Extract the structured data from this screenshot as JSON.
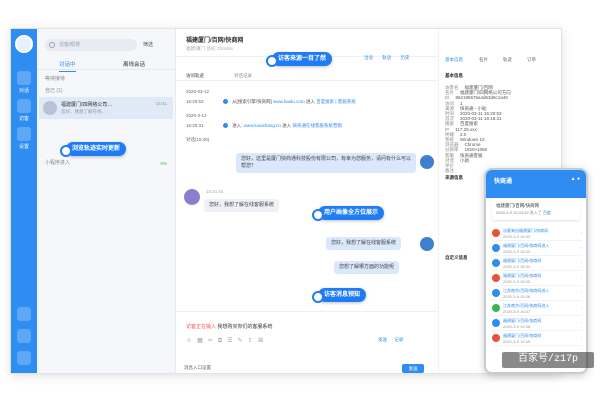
{
  "rail": {
    "labels": [
      "对话",
      "访客",
      "设置"
    ]
  },
  "contacts": {
    "search_placeholder": "访客/昵称",
    "filter_label": "筛选",
    "tabs": [
      "对话中",
      "离线会话"
    ],
    "group_labels": [
      "等待接待",
      "自己 (1)",
      "小程序进入"
    ],
    "visitor_name": "福建厦门/四网络公司…",
    "visitor_time": "15:41",
    "visitor_sub": "您好，我想了解在线…",
    "percent": "0%"
  },
  "main": {
    "title": "福建厦门/百网/快商网",
    "subtitle": "福建/厦门  访问  Chrome",
    "header_tabs": [
      "洽谈",
      "轨迹",
      "历史"
    ],
    "track_label": "访问轨迹",
    "track_label2": "对话记录",
    "tracks": [
      {
        "date": "2020-03-12",
        "time": "15:20:53",
        "src": "从[搜索引擎/快商网]",
        "link": "www.baidu.com",
        "enter": "进入",
        "lp": "百度搜索 | 客服系统"
      },
      {
        "date": "2020-3-12",
        "time": "15:20:31",
        "src": "进入:",
        "link": "www.kuaishang.cn",
        "enter": "进入",
        "lp": "快商通在线客服系统营销"
      }
    ],
    "dialog_tag": "对话(15:40)",
    "msgs": [
      {
        "text": "您好，这里是厦门快商通科技股份有限公司，有幸为您服务，请问有什么可以帮您？",
        "side": "right"
      },
      {
        "time": "15:41:54",
        "text": "您好，我想了解在线客服系统",
        "side": "left"
      },
      {
        "text": "您好，我想了解在线客服系统",
        "side": "right"
      },
      {
        "text": "您想了解哪方面的功能呢",
        "side": "right"
      }
    ],
    "typing_tag": "访客正在输入",
    "typing_text": "我想购买你们的客服系统",
    "tools": [
      "☺",
      "▦",
      "✂",
      "⧉",
      "☰",
      "✎",
      "⇧",
      "⌘"
    ],
    "send_links": [
      "发送",
      "记录"
    ],
    "auto_label": "消息入口设置",
    "send_btn": "发送"
  },
  "sidebar": {
    "tabs": [
      "基本信息",
      "名片",
      "轨迹",
      "订单"
    ],
    "sec1": "基本信息",
    "rows": [
      {
        "k": "访客名",
        "v": "福建厦门/百网"
      },
      {
        "k": "名片",
        "v": "福建厦门/四网络公司方向"
      },
      {
        "k": "ID",
        "v": "862195576a4d63d9c1a48"
      },
      {
        "k": "访问",
        "v": "1"
      },
      {
        "k": "来源",
        "v": "快商通 - 小助"
      },
      {
        "k": "时间",
        "v": "2020-03-11 15:20:53"
      },
      {
        "k": "首次",
        "v": "2020-03-11 15:15:31"
      },
      {
        "k": "搜索",
        "v": "百度搜索"
      },
      {
        "k": "IP",
        "v": "117.25.xxx"
      },
      {
        "k": "终端",
        "v": "2.0"
      },
      {
        "k": "系统",
        "v": "Windows 10"
      },
      {
        "k": "浏览器",
        "v": "Chrome"
      },
      {
        "k": "分辨率",
        "v": "1920×1080"
      },
      {
        "k": "客服",
        "v": "快商通客服"
      },
      {
        "k": "对话",
        "v": "小助"
      },
      {
        "k": "评价",
        "v": ""
      },
      {
        "k": "备注",
        "v": ""
      }
    ],
    "sec2": "来源信息",
    "sec3": "自定义信息"
  },
  "callouts": {
    "c1": "访客来源一目了然",
    "c2": "浏览轨迹实时更新",
    "c3": "用户画像全方位展示",
    "c4": "访客消息预知"
  },
  "phone": {
    "logo": "快商通",
    "icons": "▲ ●",
    "card_title": "福建厦门/百网/快商网",
    "card_sub": "2020-3-9 15:33:52 进入了",
    "card_link": "百度",
    "section": "访问轨迹",
    "items": [
      {
        "t": "访客来自福建厦门/快商网",
        "s": "2020-3-9 15:33"
      },
      {
        "t": "福建厦门/百网/快商网进入",
        "s": "2020-3-9 15:33"
      },
      {
        "t": "福建厦门/百网/快商网",
        "s": "2020-3-9 15:34"
      },
      {
        "t": "福建厦门/百网/快商网",
        "s": "2020-3-9 15:35"
      },
      {
        "t": "江苏南京/百网/快商网进入",
        "s": "2020-3-9 15:36"
      },
      {
        "t": "江苏南京/百网/快商网进入",
        "s": "2020-3-9 15:37"
      },
      {
        "t": "福建厦门/百网/快商网",
        "s": "2020-3-9 15:38"
      },
      {
        "t": "福建厦门/百网/快商网",
        "s": "2020-3-9 15:39"
      }
    ],
    "colors": [
      "#e5533d",
      "#2f8cf0",
      "#2f8cf0",
      "#e5533d",
      "#2f8cf0",
      "#3bb54a",
      "#2f8cf0",
      "#e5533d"
    ]
  },
  "watermark": "百家号/z17p",
  "colors": {
    "accent": "#2f8cf0",
    "pill": "#1f7cf5"
  }
}
